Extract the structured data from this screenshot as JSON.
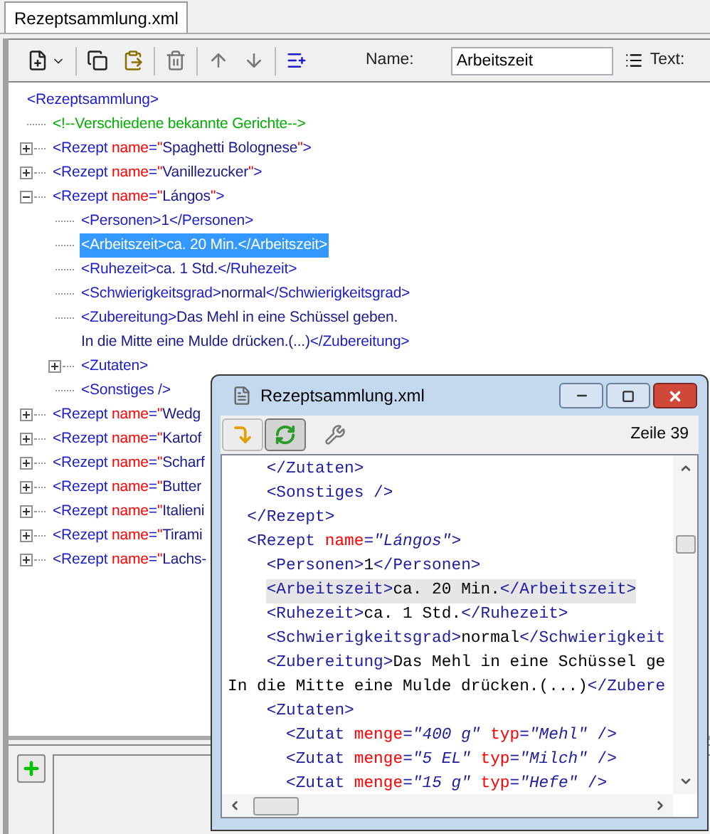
{
  "tab": {
    "label": "Rezeptsammlung.xml",
    "selected": true
  },
  "toolbar": {
    "name_label": "Name:",
    "name_value": "Arbeitszeit",
    "text_label": "Text:"
  },
  "tree": {
    "selected": false,
    "tokens": [
      {
        "kind": "tag",
        "text": "<Rezeptsammlung>"
      }
    ],
    "children": [
      {
        "selected": false,
        "tokens": [
          {
            "kind": "comment",
            "text": "<!--Verschiedene bekannte Gerichte-->"
          }
        ]
      },
      {
        "selected": false,
        "expanded": false,
        "tokens": [
          {
            "kind": "tag",
            "text": "<Rezept "
          },
          {
            "kind": "attr",
            "text": "name"
          },
          {
            "kind": "tag",
            "text": "="
          },
          {
            "kind": "quote",
            "text": "\""
          },
          {
            "kind": "value",
            "text": "Spaghetti Bolognese"
          },
          {
            "kind": "quote",
            "text": "\""
          },
          {
            "kind": "tag",
            "text": ">"
          }
        ]
      },
      {
        "selected": false,
        "expanded": false,
        "tokens": [
          {
            "kind": "tag",
            "text": "<Rezept "
          },
          {
            "kind": "attr",
            "text": "name"
          },
          {
            "kind": "tag",
            "text": "="
          },
          {
            "kind": "quote",
            "text": "\""
          },
          {
            "kind": "value",
            "text": "Vanillezucker"
          },
          {
            "kind": "quote",
            "text": "\""
          },
          {
            "kind": "tag",
            "text": ">"
          }
        ]
      },
      {
        "selected": false,
        "expanded": true,
        "tokens": [
          {
            "kind": "tag",
            "text": "<Rezept "
          },
          {
            "kind": "attr",
            "text": "name"
          },
          {
            "kind": "tag",
            "text": "="
          },
          {
            "kind": "quote",
            "text": "\""
          },
          {
            "kind": "value",
            "text": "Lángos"
          },
          {
            "kind": "quote",
            "text": "\""
          },
          {
            "kind": "tag",
            "text": ">"
          }
        ],
        "children": [
          {
            "selected": false,
            "tokens": [
              {
                "kind": "tag",
                "text": "<Personen>"
              },
              {
                "kind": "text",
                "text": "1"
              },
              {
                "kind": "tag",
                "text": "</Personen>"
              }
            ]
          },
          {
            "selected": true,
            "tokens": [
              {
                "kind": "tag",
                "text": "<Arbeitszeit>"
              },
              {
                "kind": "text",
                "text": "ca. 20 Min."
              },
              {
                "kind": "tag",
                "text": "</Arbeitszeit>"
              }
            ]
          },
          {
            "selected": false,
            "tokens": [
              {
                "kind": "tag",
                "text": "<Ruhezeit>"
              },
              {
                "kind": "text",
                "text": "ca. 1 Std."
              },
              {
                "kind": "tag",
                "text": "</Ruhezeit>"
              }
            ]
          },
          {
            "selected": false,
            "tokens": [
              {
                "kind": "tag",
                "text": "<Schwierigkeitsgrad>"
              },
              {
                "kind": "text",
                "text": "normal"
              },
              {
                "kind": "tag",
                "text": "</Schwierigkeitsgrad>"
              }
            ]
          },
          {
            "selected": false,
            "tokens": [
              {
                "kind": "tag",
                "text": "<Zubereitung>"
              },
              {
                "kind": "text",
                "text": "Das Mehl in eine Schüssel geben.\nIn die Mitte eine Mulde drücken.(...)"
              },
              {
                "kind": "tag",
                "text": "</Zubereitung>"
              }
            ]
          },
          {
            "selected": false,
            "expanded": false,
            "tokens": [
              {
                "kind": "tag",
                "text": "<Zutaten>"
              }
            ]
          },
          {
            "selected": false,
            "tokens": [
              {
                "kind": "tag",
                "text": "<Sonstiges />"
              }
            ]
          }
        ]
      },
      {
        "selected": false,
        "expanded": false,
        "tokens": [
          {
            "kind": "tag",
            "text": "<Rezept "
          },
          {
            "kind": "attr",
            "text": "name"
          },
          {
            "kind": "tag",
            "text": "="
          },
          {
            "kind": "quote",
            "text": "\""
          },
          {
            "kind": "value",
            "text": "Wedg"
          }
        ]
      },
      {
        "selected": false,
        "expanded": false,
        "tokens": [
          {
            "kind": "tag",
            "text": "<Rezept "
          },
          {
            "kind": "attr",
            "text": "name"
          },
          {
            "kind": "tag",
            "text": "="
          },
          {
            "kind": "quote",
            "text": "\""
          },
          {
            "kind": "value",
            "text": "Kartof"
          }
        ]
      },
      {
        "selected": false,
        "expanded": false,
        "tokens": [
          {
            "kind": "tag",
            "text": "<Rezept "
          },
          {
            "kind": "attr",
            "text": "name"
          },
          {
            "kind": "tag",
            "text": "="
          },
          {
            "kind": "quote",
            "text": "\""
          },
          {
            "kind": "value",
            "text": "Scharf"
          }
        ]
      },
      {
        "selected": false,
        "expanded": false,
        "tokens": [
          {
            "kind": "tag",
            "text": "<Rezept "
          },
          {
            "kind": "attr",
            "text": "name"
          },
          {
            "kind": "tag",
            "text": "="
          },
          {
            "kind": "quote",
            "text": "\""
          },
          {
            "kind": "value",
            "text": "Butter"
          }
        ]
      },
      {
        "selected": false,
        "expanded": false,
        "tokens": [
          {
            "kind": "tag",
            "text": "<Rezept "
          },
          {
            "kind": "attr",
            "text": "name"
          },
          {
            "kind": "tag",
            "text": "="
          },
          {
            "kind": "quote",
            "text": "\""
          },
          {
            "kind": "value",
            "text": "Italieni"
          }
        ]
      },
      {
        "selected": false,
        "expanded": false,
        "tokens": [
          {
            "kind": "tag",
            "text": "<Rezept "
          },
          {
            "kind": "attr",
            "text": "name"
          },
          {
            "kind": "tag",
            "text": "="
          },
          {
            "kind": "quote",
            "text": "\""
          },
          {
            "kind": "value",
            "text": "Tirami"
          }
        ]
      },
      {
        "selected": false,
        "expanded": false,
        "tokens": [
          {
            "kind": "tag",
            "text": "<Rezept "
          },
          {
            "kind": "attr",
            "text": "name"
          },
          {
            "kind": "tag",
            "text": "="
          },
          {
            "kind": "quote",
            "text": "\""
          },
          {
            "kind": "value",
            "text": "Lachs-"
          }
        ]
      }
    ]
  },
  "editor_window": {
    "title": "Rezeptsammlung.xml",
    "line_status": "Zeile 39",
    "tool_buttons": [
      {
        "kind": "step",
        "selected": false
      },
      {
        "kind": "sync",
        "selected": true
      }
    ],
    "lines": [
      {
        "highlighted": false,
        "tokens": [
          {
            "kind": "tag",
            "text": "    </Zutaten>"
          }
        ]
      },
      {
        "highlighted": false,
        "tokens": [
          {
            "kind": "tag",
            "text": "    <Sonstiges />"
          }
        ]
      },
      {
        "highlighted": false,
        "tokens": [
          {
            "kind": "tag",
            "text": "  </Rezept>"
          }
        ]
      },
      {
        "highlighted": false,
        "tokens": [
          {
            "kind": "tag",
            "text": "  <Rezept "
          },
          {
            "kind": "attr",
            "text": "name"
          },
          {
            "kind": "tag",
            "text": "="
          },
          {
            "kind": "value",
            "text": "\"Lángos\""
          },
          {
            "kind": "tag",
            "text": ">"
          }
        ]
      },
      {
        "highlighted": false,
        "tokens": [
          {
            "kind": "tag",
            "text": "    <Personen>"
          },
          {
            "kind": "text",
            "text": "1"
          },
          {
            "kind": "tag",
            "text": "</Personen>"
          }
        ]
      },
      {
        "highlighted": true,
        "tokens": [
          {
            "kind": "tag",
            "text": "    <Arbeitszeit>"
          },
          {
            "kind": "text",
            "text": "ca. 20 Min."
          },
          {
            "kind": "tag",
            "text": "</Arbeitszeit>"
          }
        ]
      },
      {
        "highlighted": false,
        "tokens": [
          {
            "kind": "tag",
            "text": "    <Ruhezeit>"
          },
          {
            "kind": "text",
            "text": "ca. 1 Std."
          },
          {
            "kind": "tag",
            "text": "</Ruhezeit>"
          }
        ]
      },
      {
        "highlighted": false,
        "tokens": [
          {
            "kind": "tag",
            "text": "    <Schwierigkeitsgrad>"
          },
          {
            "kind": "text",
            "text": "normal"
          },
          {
            "kind": "tag",
            "text": "</Schwierigkeit"
          }
        ]
      },
      {
        "highlighted": false,
        "tokens": [
          {
            "kind": "tag",
            "text": "    <Zubereitung>"
          },
          {
            "kind": "text",
            "text": "Das Mehl in eine Schüssel ge"
          }
        ]
      },
      {
        "highlighted": false,
        "tokens": [
          {
            "kind": "text",
            "text": "In die Mitte eine Mulde drücken.(...)"
          },
          {
            "kind": "tag",
            "text": "</Zubere"
          }
        ]
      },
      {
        "highlighted": false,
        "tokens": [
          {
            "kind": "tag",
            "text": "    <Zutaten>"
          }
        ]
      },
      {
        "highlighted": false,
        "tokens": [
          {
            "kind": "tag",
            "text": "      <Zutat "
          },
          {
            "kind": "attr",
            "text": "menge"
          },
          {
            "kind": "tag",
            "text": "="
          },
          {
            "kind": "value",
            "text": "\"400 g\""
          },
          {
            "kind": "attr",
            "text": " typ"
          },
          {
            "kind": "tag",
            "text": "="
          },
          {
            "kind": "value",
            "text": "\"Mehl\""
          },
          {
            "kind": "tag",
            "text": " />"
          }
        ]
      },
      {
        "highlighted": false,
        "tokens": [
          {
            "kind": "tag",
            "text": "      <Zutat "
          },
          {
            "kind": "attr",
            "text": "menge"
          },
          {
            "kind": "tag",
            "text": "="
          },
          {
            "kind": "value",
            "text": "\"5 EL\""
          },
          {
            "kind": "attr",
            "text": " typ"
          },
          {
            "kind": "tag",
            "text": "="
          },
          {
            "kind": "value",
            "text": "\"Milch\""
          },
          {
            "kind": "tag",
            "text": " />"
          }
        ]
      },
      {
        "highlighted": false,
        "tokens": [
          {
            "kind": "tag",
            "text": "      <Zutat "
          },
          {
            "kind": "attr",
            "text": "menge"
          },
          {
            "kind": "tag",
            "text": "="
          },
          {
            "kind": "value",
            "text": "\"15 g\""
          },
          {
            "kind": "attr",
            "text": " typ"
          },
          {
            "kind": "tag",
            "text": "="
          },
          {
            "kind": "value",
            "text": "\"Hefe\""
          },
          {
            "kind": "tag",
            "text": " />"
          }
        ]
      }
    ]
  }
}
